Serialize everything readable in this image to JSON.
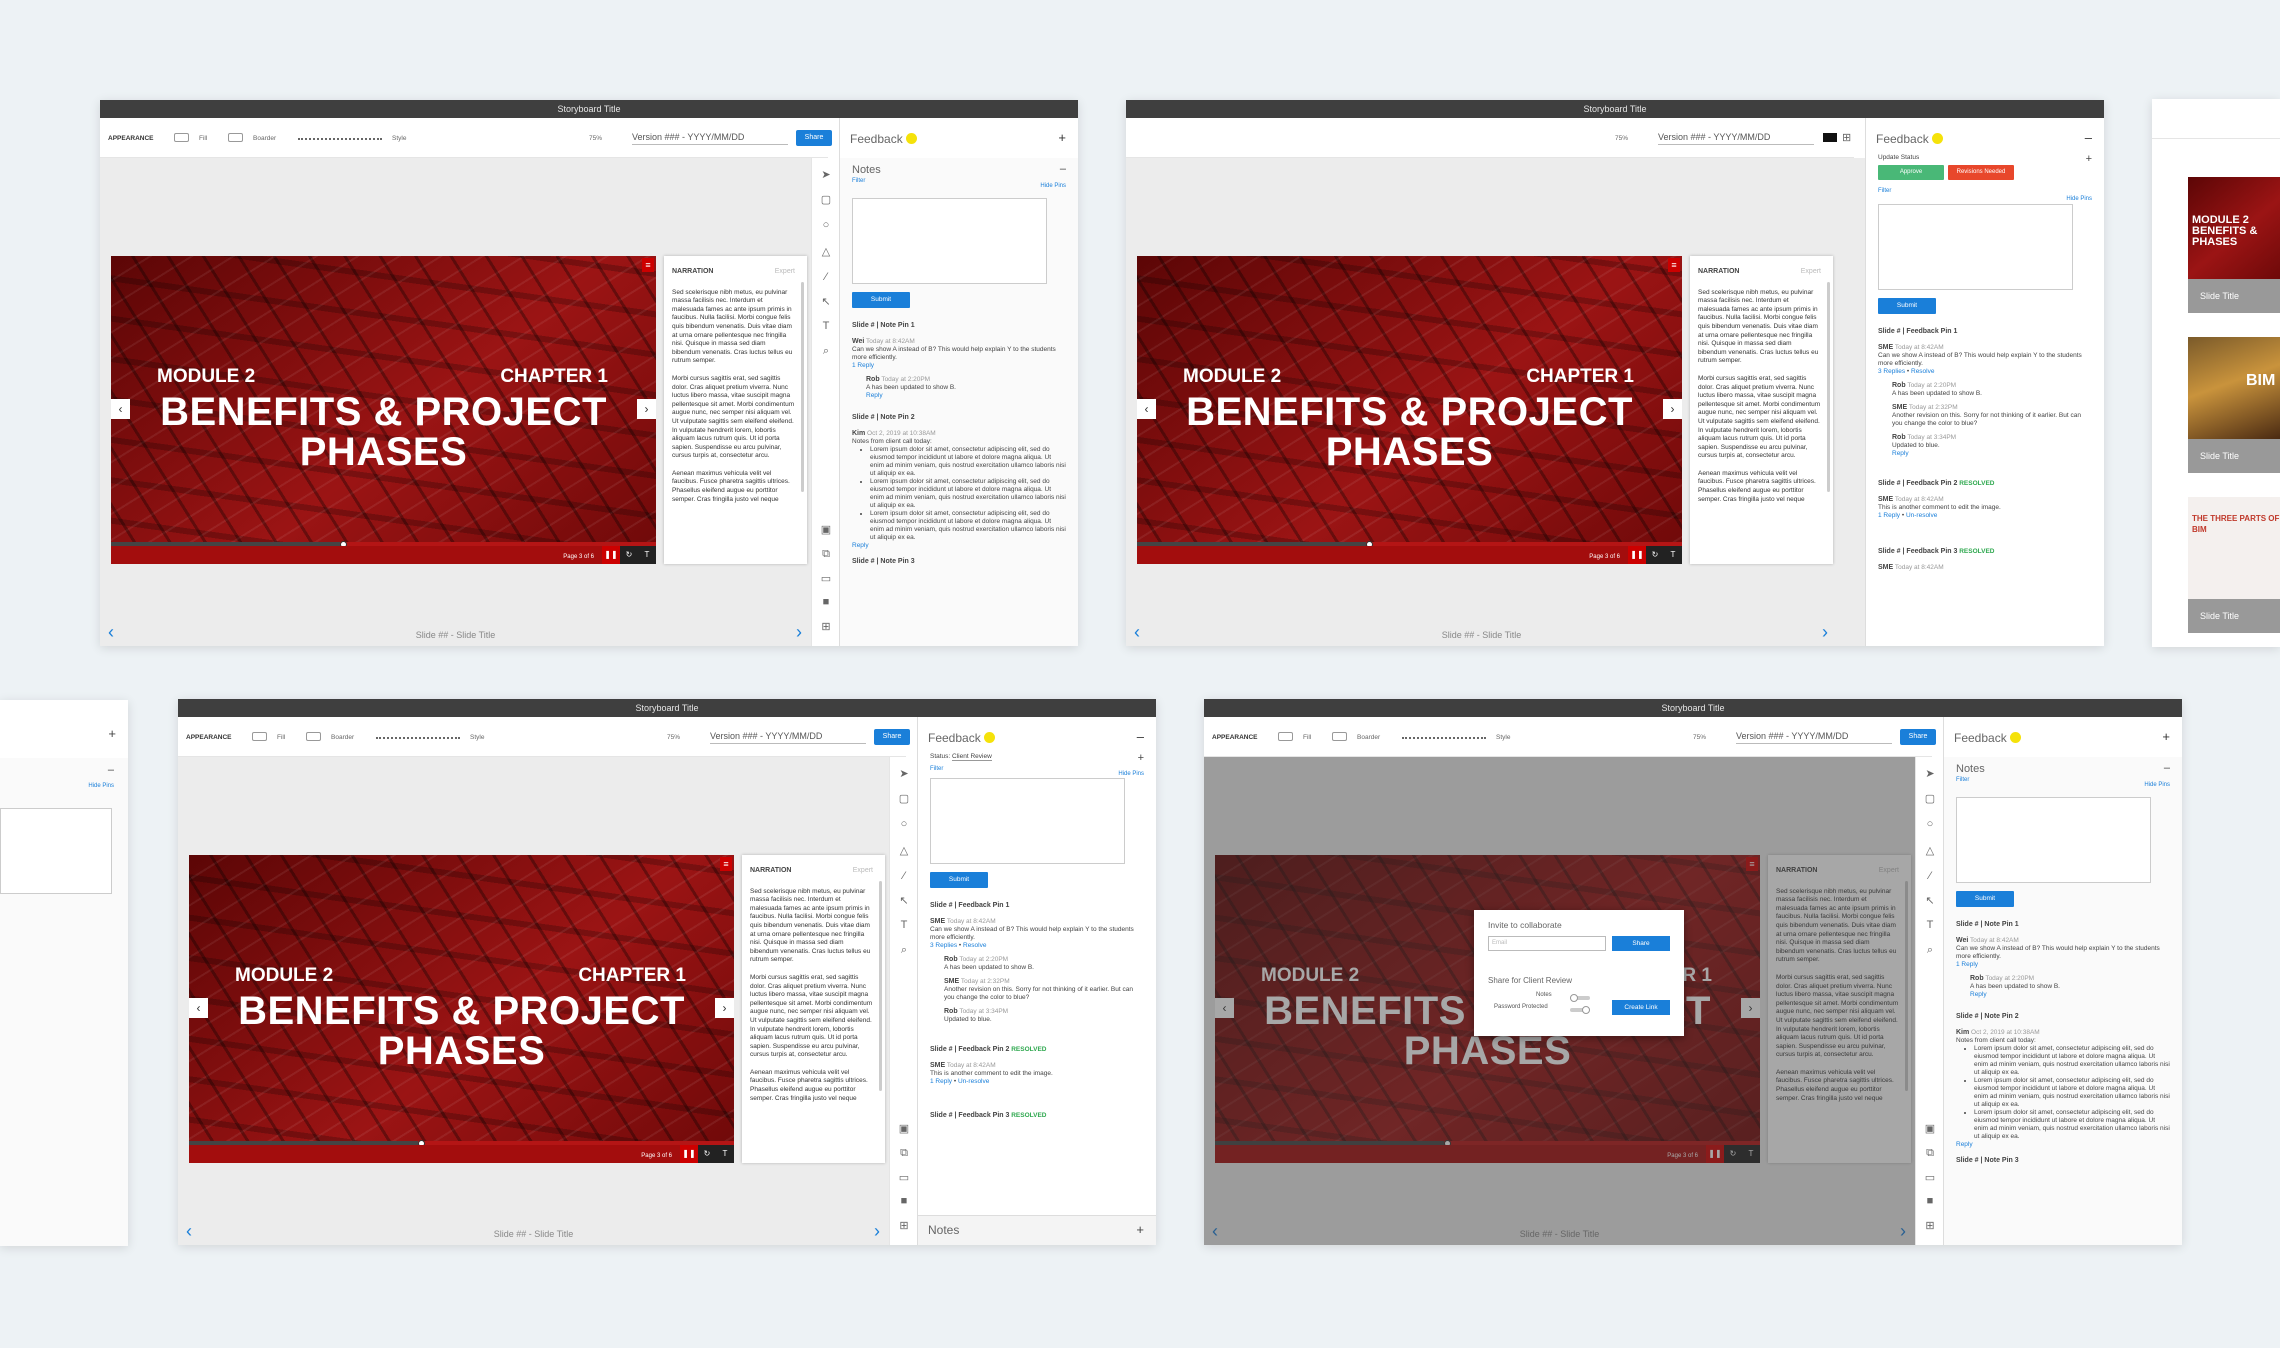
{
  "app": {
    "window_title": "Storyboard Title",
    "appearance_label": "APPEARANCE",
    "fill_label": "Fill",
    "border_label": "Boarder",
    "style_label": "Style",
    "zoom": "75%",
    "version": "Version ### - YYYY/MM/DD",
    "share_button": "Share"
  },
  "slide": {
    "module": "MODULE 2",
    "chapter": "CHAPTER 1",
    "title_line1": "BENEFITS & PROJECT",
    "title_line2": "PHASES",
    "page": "Page 3 of 6",
    "progress": 0.42,
    "footer": "Slide ## - Slide Title"
  },
  "narration": {
    "heading": "NARRATION",
    "expand": "Expert",
    "p1": "Sed scelerisque nibh metus, eu pulvinar massa facilisis nec. Interdum et malesuada fames ac ante ipsum primis in faucibus. Nulla facilisi. Morbi congue felis quis bibendum venenatis. Duis vitae diam at urna ornare pellentesque nec fringilla nisi. Quisque in massa sed diam bibendum venenatis. Cras luctus tellus eu rutrum semper.",
    "p2": "Morbi cursus sagittis erat, sed sagittis dolor. Cras aliquet pretium viverra. Nunc luctus libero massa, vitae suscipit magna pellentesque sit amet. Morbi condimentum augue nunc, nec semper nisi aliquam vel. Ut vulputate sagittis sem eleifend eleifend. In vulputate hendrerit lorem, lobortis aliquam lacus rutrum quis. Ut id porta sapien. Suspendisse eu arcu pulvinar, cursus turpis at, consectetur arcu.",
    "p3": "Aenean maximus vehicula velit vel faucibus. Fusce pharetra sagittis ultrices. Phasellus eleifend augue eu porttitor semper. Cras fringilla justo vel neque"
  },
  "feedback": {
    "title": "Feedback",
    "notes_title": "Notes",
    "filter": "Filter",
    "hide_pins": "Hide Pins",
    "submit": "Submit",
    "update_status": "Update Status",
    "approve": "Approve",
    "revisions": "Revisions Needed",
    "status_label": "Status:",
    "status_value": "Client Review",
    "note1_title": "Slide # | Note Pin 1",
    "note1_author": "Wei",
    "note1_time": "Today at 8:42AM",
    "note1_text": "Can we show A instead of B? This would help explain Y to the students more efficiently.",
    "note1_replies": "1 Reply",
    "note1_r_author": "Rob",
    "note1_r_time": "Today at 2:20PM",
    "note1_r_text": "A has been updated to show B.",
    "reply": "Reply",
    "note2_title": "Slide # | Note Pin 2",
    "note2_author": "Kim",
    "note2_time": "Oct 2, 2019 at 10:38AM",
    "note2_text": "Notes from client call today:",
    "bullet": "Lorem ipsum dolor sit amet, consectetur adipiscing elit, sed do eiusmod tempor incididunt ut labore et dolore magna aliqua. Ut enim ad minim veniam, quis nostrud exercitation ullamco laboris nisi ut aliquip ex ea.",
    "note3_title": "Slide # | Note Pin 3",
    "fb1_title": "Slide # | Feedback Pin 1",
    "fb1_author": "SME",
    "fb1_time": "Today at 8:42AM",
    "fb1_text": "Can we show A instead of B? This would help explain Y to the students more efficiently.",
    "fb1_replies": "3 Replies",
    "resolve": "Resolve",
    "fb1_r1_author": "Rob",
    "fb1_r1_time": "Today at 2:20PM",
    "fb1_r1_text": "A has been updated to show B.",
    "fb1_r2_author": "SME",
    "fb1_r2_time": "Today at 2:32PM",
    "fb1_r2_text": "Another revision on this. Sorry for not thinking of it earlier. But can you change the color to blue?",
    "fb1_r3_author": "Rob",
    "fb1_r3_time": "Today at 3:34PM",
    "fb1_r3_text": "Updated to blue.",
    "fb2_title": "Slide # | Feedback Pin 2",
    "resolved": "RESOLVED",
    "fb2_author": "SME",
    "fb2_time": "Today at 8:42AM",
    "fb2_text": "This is another comment to edit the image.",
    "fb2_replies": "1 Reply",
    "unresolve": "Un-resolve",
    "fb3_title": "Slide # | Feedback Pin 3"
  },
  "modal": {
    "title": "Invite to collaborate",
    "email_placeholder": "Email",
    "share": "Share",
    "share_review": "Share for Client Review",
    "notes": "Notes",
    "password": "Password Protected",
    "create_link": "Create Link"
  },
  "thumbs": {
    "t1_title": "MODULE 2 BENEFITS & PHASES",
    "t2_title": "BIM",
    "t3_title": "THE THREE PARTS OF BIM",
    "caption": "Slide Title"
  },
  "colors": {
    "accent": "#1a7fd9",
    "slide_red": "#8c0f0f",
    "approve": "#49b877",
    "revisions": "#e8472b",
    "feedback_dot": "#f5e20a"
  }
}
